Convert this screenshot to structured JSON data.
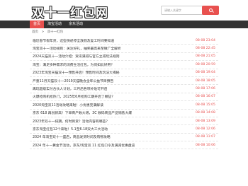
{
  "site": {
    "logo": "双十一红包网"
  },
  "search": {
    "placeholder": "请输入关键字"
  },
  "nav": [
    {
      "label": "首页"
    },
    {
      "label": "淘宝活动"
    },
    {
      "label": "京东活动"
    }
  ],
  "breadcrumb": {
    "home": "首页",
    "sep": ">",
    "current": "双十一红包"
  },
  "articles": [
    {
      "title": "临近春节假年货，这些快递停全放假及复工时间要知道",
      "date": "08-08 23:04"
    },
    {
      "title": "淘宝双十一活动规则：关注好礼，抽奖最高来至微广全解析",
      "date": "08-08 22:45"
    },
    {
      "title": "2024天猫双十一活动介绍：资讯满减与官方立减玩法规则",
      "date": "08-08 21:05"
    },
    {
      "title": "淘宝：满足多种需求的消费生活红包，为何如此好用？",
      "date": "08-08 20:59"
    },
    {
      "title": "2023年淘宝天猫双十一预售开启！预售时间及玩法大揭秘",
      "date": "08-08 19:04"
    },
    {
      "title": "严重11月天猫双十一2019天猫晚会全年公益节目预告",
      "date": "08-08 18:05"
    },
    {
      "title": "再玩超级实付合伙人计划，三月后各项补贴可开启",
      "date": "08-08 17:06"
    },
    {
      "title": "火爆抢购机抢热门，2025年6月抢购工期开启了哪些？",
      "date": "08-08 16:07"
    },
    {
      "title": "2020淘宝双11活动攻略来啦！小优惠完满解读",
      "date": "08-08 15:05"
    },
    {
      "title": "京东 618 再创新高！下单商户数大增，3C 数码商品产品销售大爆",
      "date": "08-08 14:08"
    },
    {
      "title": "2023年双十一排期，何时到货？活动内容有哪些？",
      "date": "08-08 13:09"
    },
    {
      "title": "京东淘宝红包12个来啦！5.1至6.18双大工大活动",
      "date": "08-08 12:06"
    },
    {
      "title": "2024 年淘宝双十一盛启，商品发货时间及购物攻略",
      "date": "08-08 11:07"
    },
    {
      "title": "2024 年十一黄金节活动，京东/淘宝双 11 红包口令及满减优惠盘览",
      "date": "08-08 10:06"
    }
  ]
}
